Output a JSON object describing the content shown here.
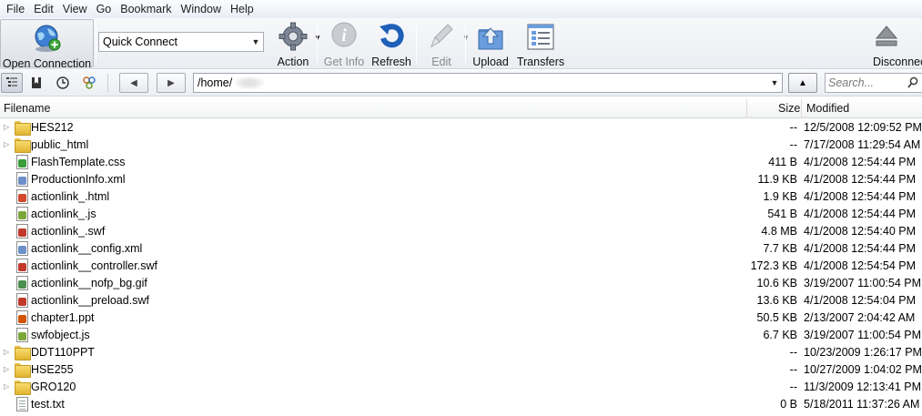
{
  "menu": [
    "File",
    "Edit",
    "View",
    "Go",
    "Bookmark",
    "Window",
    "Help"
  ],
  "toolbar": {
    "open_connection": "Open Connection",
    "quick_connect": "Quick Connect",
    "action": "Action",
    "get_info": "Get Info",
    "refresh": "Refresh",
    "edit": "Edit",
    "upload": "Upload",
    "transfers": "Transfers",
    "disconnect": "Disconnect"
  },
  "nav": {
    "path": "/home/",
    "search_placeholder": "Search..."
  },
  "columns": {
    "filename": "Filename",
    "size": "Size",
    "modified": "Modified"
  },
  "files": [
    {
      "name": "HES212",
      "size": "--",
      "modified": "12/5/2008 12:09:52 PM",
      "kind": "folder"
    },
    {
      "name": "public_html",
      "size": "--",
      "modified": "7/17/2008 11:29:54 AM",
      "kind": "folder"
    },
    {
      "name": "FlashTemplate.css",
      "size": "411 B",
      "modified": "4/1/2008 12:54:44 PM",
      "kind": "css"
    },
    {
      "name": "ProductionInfo.xml",
      "size": "11.9 KB",
      "modified": "4/1/2008 12:54:44 PM",
      "kind": "xml"
    },
    {
      "name": "actionlink_.html",
      "size": "1.9 KB",
      "modified": "4/1/2008 12:54:44 PM",
      "kind": "html"
    },
    {
      "name": "actionlink_.js",
      "size": "541 B",
      "modified": "4/1/2008 12:54:44 PM",
      "kind": "js"
    },
    {
      "name": "actionlink_.swf",
      "size": "4.8 MB",
      "modified": "4/1/2008 12:54:40 PM",
      "kind": "swf"
    },
    {
      "name": "actionlink__config.xml",
      "size": "7.7 KB",
      "modified": "4/1/2008 12:54:44 PM",
      "kind": "xml"
    },
    {
      "name": "actionlink__controller.swf",
      "size": "172.3 KB",
      "modified": "4/1/2008 12:54:54 PM",
      "kind": "swf"
    },
    {
      "name": "actionlink__nofp_bg.gif",
      "size": "10.6 KB",
      "modified": "3/19/2007 11:00:54 PM",
      "kind": "gif"
    },
    {
      "name": "actionlink__preload.swf",
      "size": "13.6 KB",
      "modified": "4/1/2008 12:54:04 PM",
      "kind": "swf"
    },
    {
      "name": "chapter1.ppt",
      "size": "50.5 KB",
      "modified": "2/13/2007 2:04:42 AM",
      "kind": "ppt"
    },
    {
      "name": "swfobject.js",
      "size": "6.7 KB",
      "modified": "3/19/2007 11:00:54 PM",
      "kind": "js"
    },
    {
      "name": "DDT110PPT",
      "size": "--",
      "modified": "10/23/2009 1:26:17 PM",
      "kind": "folder"
    },
    {
      "name": "HSE255",
      "size": "--",
      "modified": "10/27/2009 1:04:02 PM",
      "kind": "folder"
    },
    {
      "name": "GRO120",
      "size": "--",
      "modified": "11/3/2009 12:13:41 PM",
      "kind": "folder"
    },
    {
      "name": "test.txt",
      "size": "0 B",
      "modified": "5/18/2011 11:37:26 AM",
      "kind": "txt"
    }
  ],
  "colors": {
    "css": "#3a9d3a",
    "xml": "#6b8fc9",
    "html": "#d4472e",
    "js": "#7aa63a",
    "swf": "#c0392b",
    "gif": "#4d8f4d",
    "ppt": "#d35400",
    "txt": "#ffffff"
  }
}
